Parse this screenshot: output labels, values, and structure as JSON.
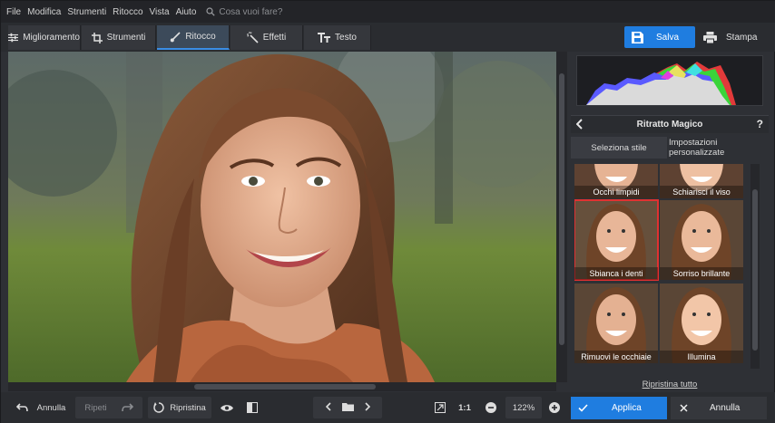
{
  "menu": [
    "File",
    "Modifica",
    "Strumenti",
    "Ritocco",
    "Vista",
    "Aiuto"
  ],
  "search": {
    "placeholder": "Cosa vuoi fare?",
    "icon": "search-icon"
  },
  "tabs": [
    {
      "label": "Miglioramento",
      "icon": "sliders-icon",
      "active": false
    },
    {
      "label": "Strumenti",
      "icon": "crop-icon",
      "active": false
    },
    {
      "label": "Ritocco",
      "icon": "brush-icon",
      "active": true
    },
    {
      "label": "Effetti",
      "icon": "magic-wand-icon",
      "active": false
    },
    {
      "label": "Testo",
      "icon": "text-icon",
      "active": false
    }
  ],
  "actions": {
    "save": "Salva",
    "print": "Stampa"
  },
  "panel": {
    "title": "Ritratto Magico",
    "help": "?",
    "subtabs": [
      "Seleziona stile",
      "Impostazioni personalizzate"
    ],
    "styles": [
      {
        "label": "Occhi limpidi",
        "selected": false
      },
      {
        "label": "Schiarisci il viso",
        "selected": false
      },
      {
        "label": "Sbianca i denti",
        "selected": true
      },
      {
        "label": "Sorriso brillante",
        "selected": false
      },
      {
        "label": "Rimuovi le occhiaie",
        "selected": false
      },
      {
        "label": "Illumina",
        "selected": false
      }
    ],
    "reset_all": "Ripristina tutto"
  },
  "bottom": {
    "undo": "Annulla",
    "redo": "Ripeti",
    "reset": "Ripristina",
    "zoom_1to1": "1:1",
    "zoom_level": "122%",
    "apply": "Applica",
    "cancel": "Annulla"
  },
  "colors": {
    "accent": "#1f7de0",
    "selection": "#e03131"
  }
}
